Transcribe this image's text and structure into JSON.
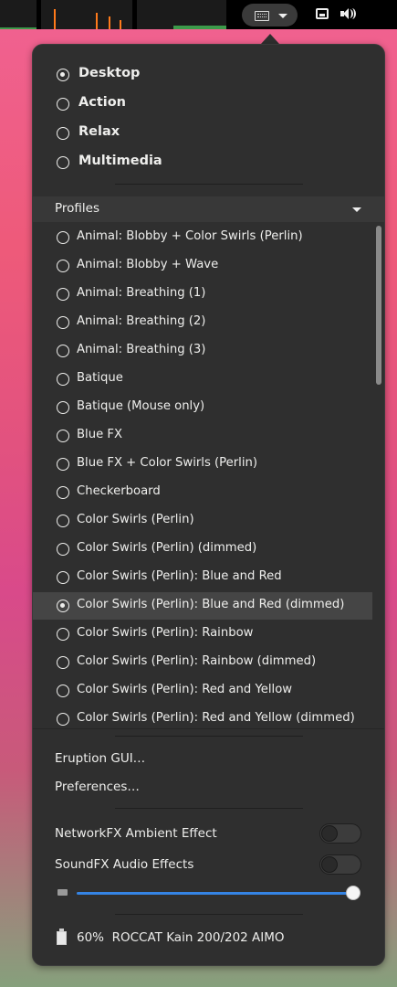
{
  "modes": [
    {
      "label": "Desktop",
      "checked": true
    },
    {
      "label": "Action",
      "checked": false
    },
    {
      "label": "Relax",
      "checked": false
    },
    {
      "label": "Multimedia",
      "checked": false
    }
  ],
  "profiles_header": "Profiles",
  "profiles": [
    {
      "label": "Animal: Blobby + Color Swirls (Perlin)",
      "checked": false
    },
    {
      "label": "Animal: Blobby + Wave",
      "checked": false
    },
    {
      "label": "Animal: Breathing (1)",
      "checked": false
    },
    {
      "label": "Animal: Breathing (2)",
      "checked": false
    },
    {
      "label": "Animal: Breathing (3)",
      "checked": false
    },
    {
      "label": "Batique",
      "checked": false
    },
    {
      "label": "Batique (Mouse only)",
      "checked": false
    },
    {
      "label": "Blue FX",
      "checked": false
    },
    {
      "label": "Blue FX + Color Swirls (Perlin)",
      "checked": false
    },
    {
      "label": "Checkerboard",
      "checked": false
    },
    {
      "label": "Color Swirls (Perlin)",
      "checked": false
    },
    {
      "label": "Color Swirls (Perlin) (dimmed)",
      "checked": false
    },
    {
      "label": "Color Swirls (Perlin): Blue and Red",
      "checked": false
    },
    {
      "label": "Color Swirls (Perlin): Blue and Red (dimmed)",
      "checked": true
    },
    {
      "label": "Color Swirls (Perlin): Rainbow",
      "checked": false
    },
    {
      "label": "Color Swirls (Perlin): Rainbow (dimmed)",
      "checked": false
    },
    {
      "label": "Color Swirls (Perlin): Red and Yellow",
      "checked": false
    },
    {
      "label": "Color Swirls (Perlin): Red and Yellow (dimmed)",
      "checked": false
    }
  ],
  "actions": {
    "eruption_gui": "Eruption GUI…",
    "preferences": "Preferences…"
  },
  "toggles": {
    "networkfx": {
      "label": "NetworkFX Ambient Effect",
      "on": false
    },
    "soundfx": {
      "label": "SoundFX Audio Effects",
      "on": false
    }
  },
  "brightness_level": 1.0,
  "device": {
    "battery": "60%",
    "name": "ROCCAT Kain 200/202 AIMO"
  },
  "colors": {
    "accent": "#3584e4",
    "menu_bg": "#2f2f2f",
    "selected_row": "#454545"
  },
  "icons": {
    "keyboard": "keyboard-icon",
    "network": "network-icon",
    "volume": "volume-icon",
    "battery": "battery-icon"
  }
}
